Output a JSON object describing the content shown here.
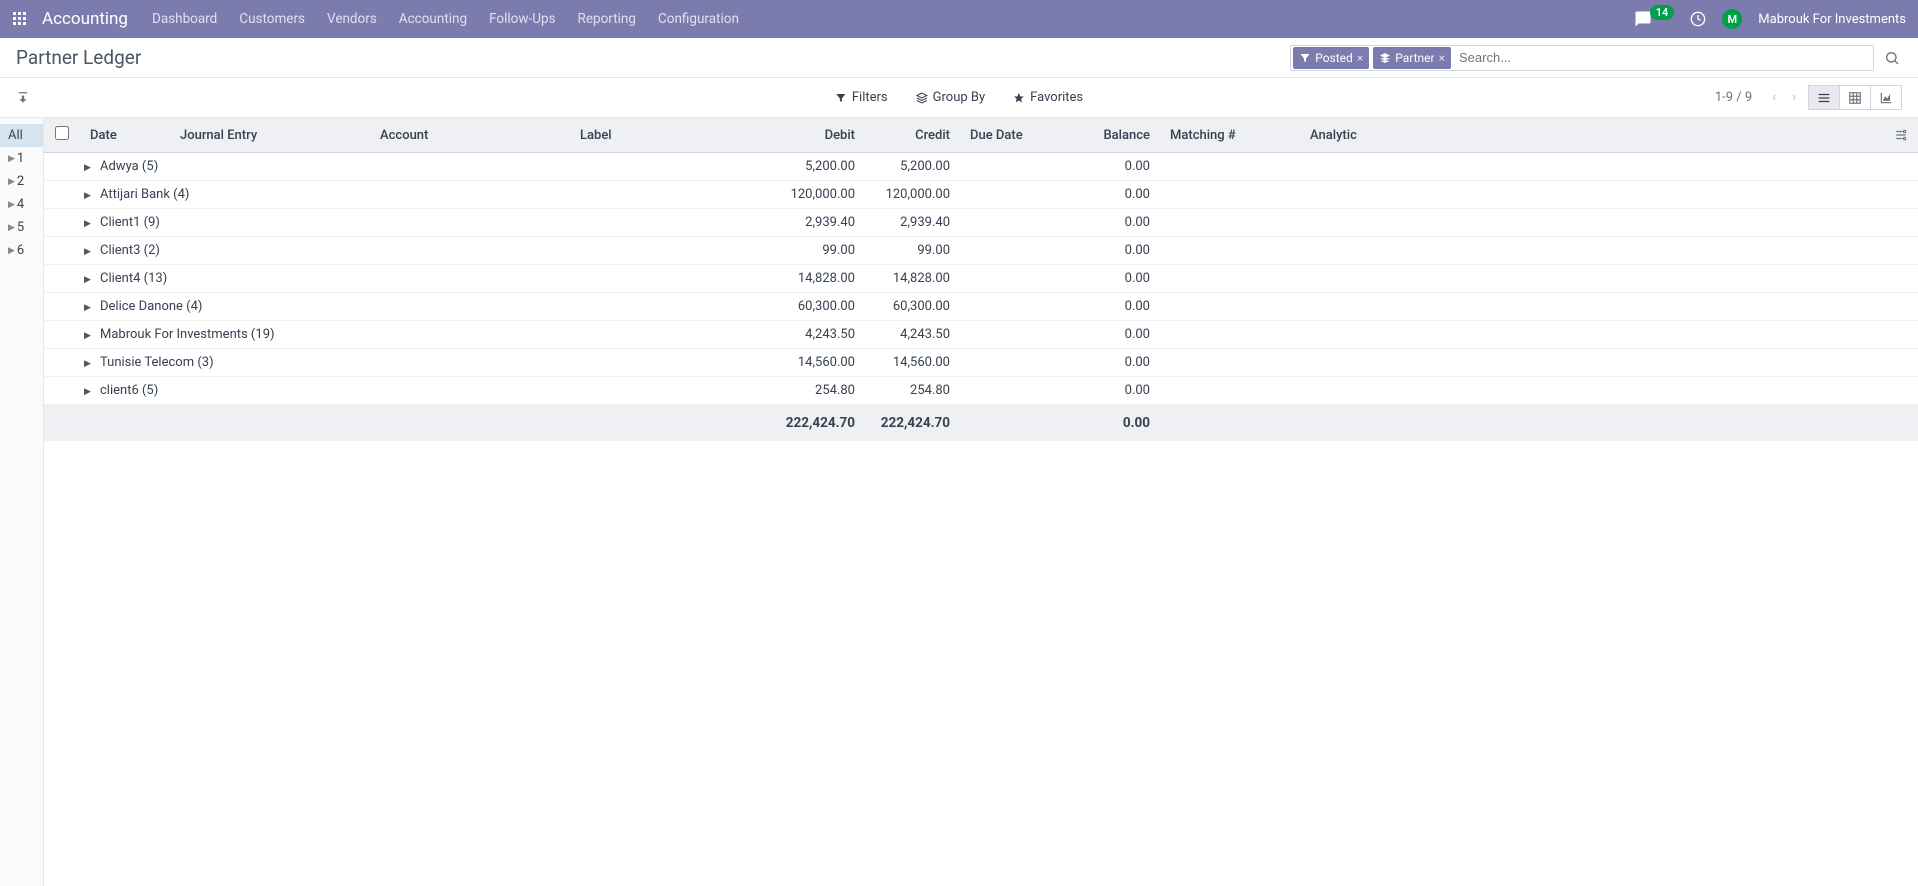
{
  "topbar": {
    "brand": "Accounting",
    "nav": [
      "Dashboard",
      "Customers",
      "Vendors",
      "Accounting",
      "Follow-Ups",
      "Reporting",
      "Configuration"
    ],
    "msg_count": "14",
    "user_initial": "M",
    "user_name": "Mabrouk For Investments"
  },
  "breadcrumb": {
    "title": "Partner Ledger"
  },
  "search": {
    "chips": [
      {
        "icon": "filter",
        "label": "Posted"
      },
      {
        "icon": "layers",
        "label": "Partner"
      }
    ],
    "placeholder": "Search..."
  },
  "tools": {
    "filters": "Filters",
    "groupby": "Group By",
    "favorites": "Favorites"
  },
  "pager": {
    "range": "1-9 / 9"
  },
  "sidebar": {
    "items": [
      "All",
      "1",
      "2",
      "4",
      "5",
      "6"
    ]
  },
  "columns": {
    "check": "",
    "date": "Date",
    "journal": "Journal Entry",
    "account": "Account",
    "label": "Label",
    "debit": "Debit",
    "credit": "Credit",
    "due": "Due Date",
    "balance": "Balance",
    "matching": "Matching #",
    "analytic": "Analytic"
  },
  "rows": [
    {
      "name": "Adwya (5)",
      "debit": "5,200.00",
      "credit": "5,200.00",
      "balance": "0.00"
    },
    {
      "name": "Attijari Bank (4)",
      "debit": "120,000.00",
      "credit": "120,000.00",
      "balance": "0.00"
    },
    {
      "name": "Client1 (9)",
      "debit": "2,939.40",
      "credit": "2,939.40",
      "balance": "0.00"
    },
    {
      "name": "Client3 (2)",
      "debit": "99.00",
      "credit": "99.00",
      "balance": "0.00"
    },
    {
      "name": "Client4 (13)",
      "debit": "14,828.00",
      "credit": "14,828.00",
      "balance": "0.00"
    },
    {
      "name": "Delice Danone (4)",
      "debit": "60,300.00",
      "credit": "60,300.00",
      "balance": "0.00"
    },
    {
      "name": "Mabrouk For Investments (19)",
      "debit": "4,243.50",
      "credit": "4,243.50",
      "balance": "0.00"
    },
    {
      "name": "Tunisie Telecom (3)",
      "debit": "14,560.00",
      "credit": "14,560.00",
      "balance": "0.00"
    },
    {
      "name": "client6 (5)",
      "debit": "254.80",
      "credit": "254.80",
      "balance": "0.00"
    }
  ],
  "totals": {
    "debit": "222,424.70",
    "credit": "222,424.70",
    "balance": "0.00"
  }
}
